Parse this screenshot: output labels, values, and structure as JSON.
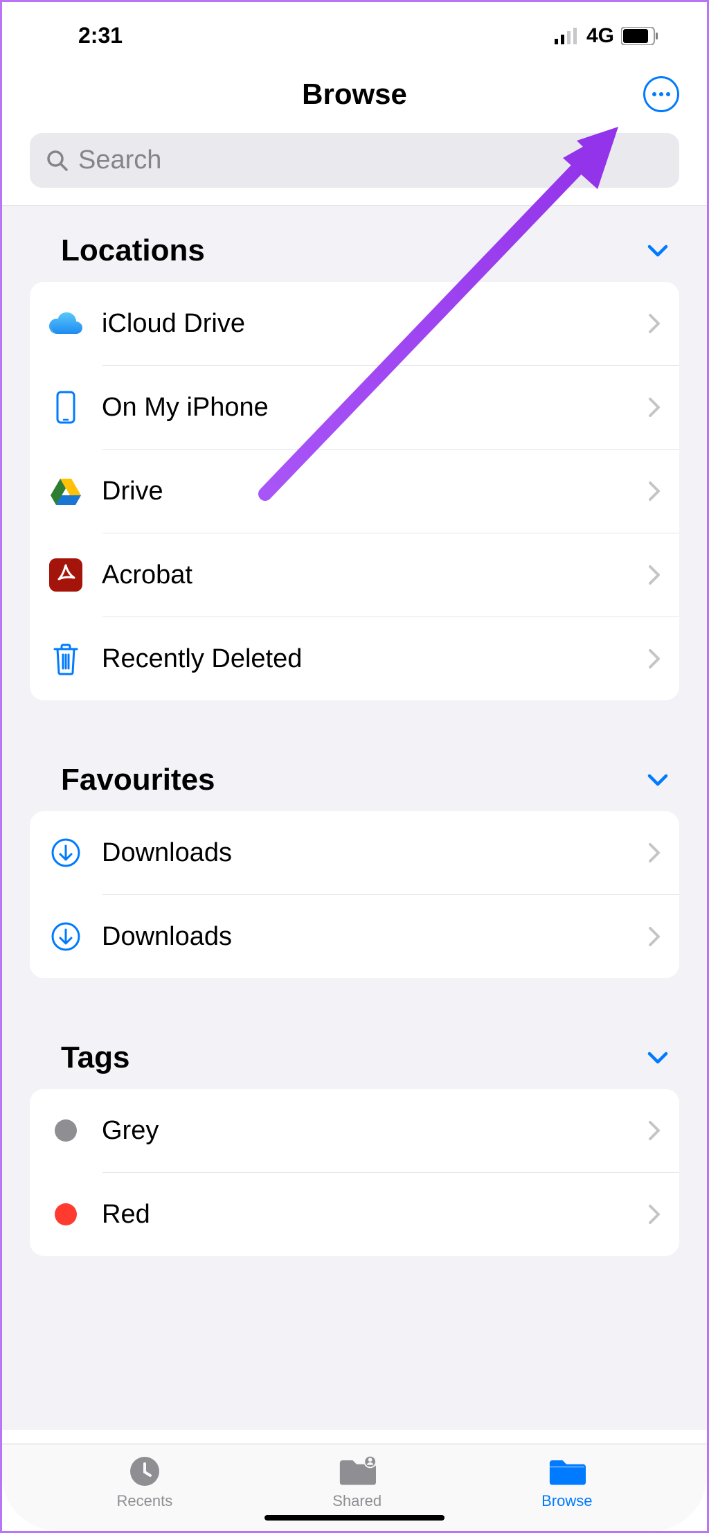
{
  "status": {
    "time": "2:31",
    "network": "4G"
  },
  "nav": {
    "title": "Browse"
  },
  "search": {
    "placeholder": "Search"
  },
  "sections": {
    "locations": {
      "title": "Locations",
      "items": [
        {
          "label": "iCloud Drive",
          "icon": "icloud"
        },
        {
          "label": "On My iPhone",
          "icon": "iphone"
        },
        {
          "label": "Drive",
          "icon": "gdrive"
        },
        {
          "label": "Acrobat",
          "icon": "acrobat"
        },
        {
          "label": "Recently Deleted",
          "icon": "trash"
        }
      ]
    },
    "favourites": {
      "title": "Favourites",
      "items": [
        {
          "label": "Downloads",
          "icon": "download"
        },
        {
          "label": "Downloads",
          "icon": "download"
        }
      ]
    },
    "tags": {
      "title": "Tags",
      "items": [
        {
          "label": "Grey",
          "color": "grey"
        },
        {
          "label": "Red",
          "color": "red"
        }
      ]
    }
  },
  "tabs": {
    "recents": "Recents",
    "shared": "Shared",
    "browse": "Browse"
  }
}
